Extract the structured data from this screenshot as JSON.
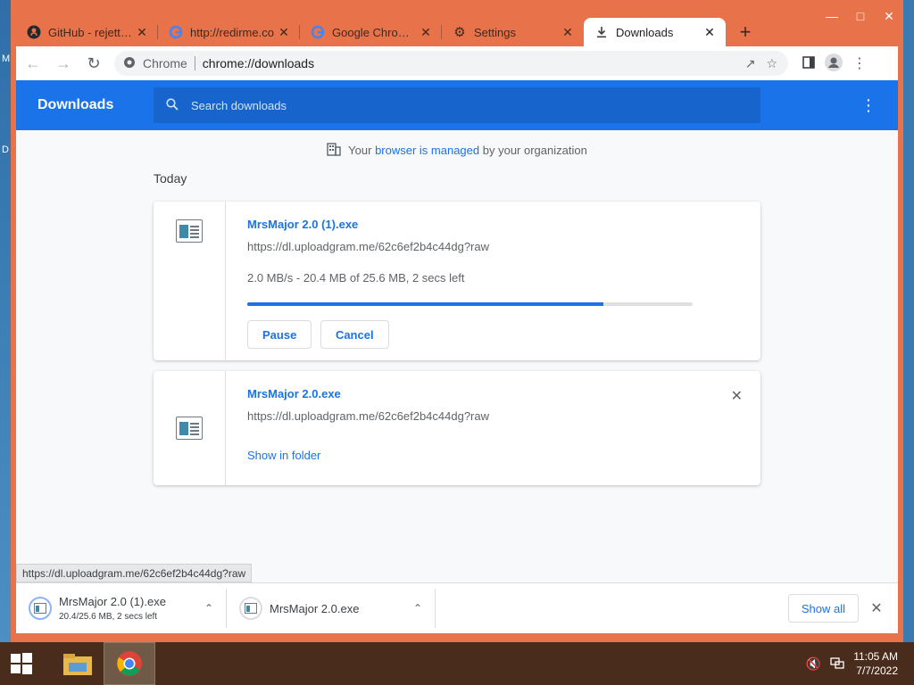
{
  "desktop": {
    "edge_letters": [
      "M",
      "D"
    ]
  },
  "browser": {
    "tabs": [
      {
        "title": "GitHub - rejetto/h",
        "icon": "github-icon",
        "active": false
      },
      {
        "title": "http://redirme.co",
        "icon": "google-icon",
        "active": false
      },
      {
        "title": "Google Chrome b",
        "icon": "google-icon",
        "active": false
      },
      {
        "title": "Settings",
        "icon": "gear-icon",
        "active": false
      },
      {
        "title": "Downloads",
        "icon": "download-icon",
        "active": true
      }
    ],
    "omnibox": {
      "site_label": "Chrome",
      "url": "chrome://downloads"
    }
  },
  "page": {
    "header_title": "Downloads",
    "search_placeholder": "Search downloads",
    "managed_prefix": "Your",
    "managed_link": "browser is managed",
    "managed_suffix": "by your organization",
    "section_date": "Today",
    "downloads": [
      {
        "name": "MrsMajor 2.0 (1).exe",
        "url": "https://dl.uploadgram.me/62c6ef2b4c44dg?raw",
        "status": "2.0 MB/s - 20.4 MB of 25.6 MB, 2 secs left",
        "progress": 0.8,
        "pause_label": "Pause",
        "cancel_label": "Cancel"
      },
      {
        "name": "MrsMajor 2.0.exe",
        "url": "https://dl.uploadgram.me/62c6ef2b4c44dg?raw",
        "show_in_folder_label": "Show in folder"
      }
    ],
    "status_bubble": "https://dl.uploadgram.me/62c6ef2b4c44dg?raw"
  },
  "shelf": {
    "items": [
      {
        "name": "MrsMajor 2.0 (1).exe",
        "sub": "20.4/25.6 MB, 2 secs left"
      },
      {
        "name": "MrsMajor 2.0.exe",
        "sub": ""
      }
    ],
    "show_all_label": "Show all"
  },
  "taskbar": {
    "time": "11:05 AM",
    "date": "7/7/2022"
  }
}
